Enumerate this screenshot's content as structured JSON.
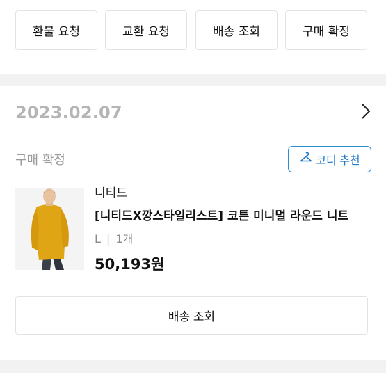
{
  "top_actions": [
    {
      "label": "환불 요청"
    },
    {
      "label": "교환 요청"
    },
    {
      "label": "배송 조회"
    },
    {
      "label": "구매 확정"
    }
  ],
  "order": {
    "date": "2023.02.07",
    "status": "구매 확정",
    "coordi_button_label": "코디 추천",
    "product": {
      "brand": "니티드",
      "title": "[니티드X깡스타일리스트] 코튼 미니멀 라운드 니트",
      "option_size": "L",
      "option_separator": "|",
      "option_quantity": "1개",
      "price": "50,193원"
    },
    "shipping_button_label": "배송 조회"
  },
  "colors": {
    "accent_blue": "#2b8fd6",
    "divider": "#f2f2f2",
    "date_gray": "#b5b5b5",
    "sweater_yellow": "#e0a515"
  },
  "icons": {
    "chevron": "chevron-right-icon",
    "coordi": "hanger-icon"
  }
}
